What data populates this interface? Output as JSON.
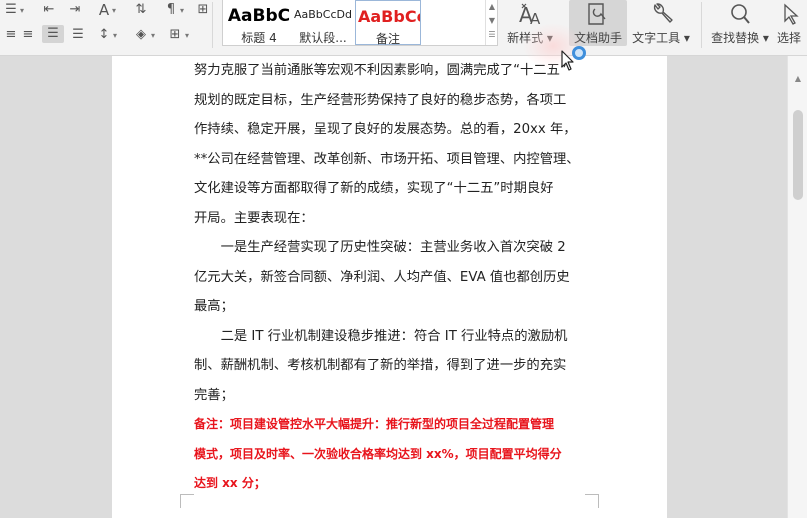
{
  "ribbon": {
    "styles": [
      {
        "preview": "AaBbC",
        "label": "标题 4"
      },
      {
        "preview": "AaBbCcDd",
        "label": "默认段..."
      },
      {
        "preview": "AaBbCcI",
        "label": "备注"
      }
    ],
    "new_style_label": "新样式",
    "doc_assistant_label": "文档助手",
    "text_tools_label": "文字工具",
    "find_replace_label": "查找替换",
    "select_label": "选择"
  },
  "document": {
    "lines": [
      "努力克服了当前通胀等宏观不利因素影响，圆满完成了“十二五”",
      "规划的既定目标，生产经营形势保持了良好的稳步态势，各项工",
      "作持续、稳定开展，呈现了良好的发展态势。总的看，20xx 年，",
      "**公司在经营管理、改革创新、市场开拓、项目管理、内控管理、",
      "文化建设等方面都取得了新的成绩，实现了“十二五”时期良好",
      "开局。主要表现在：",
      "　　一是生产经营实现了历史性突破：主营业务收入首次突破 2",
      "亿元大关，新签合同额、净利润、人均产值、EVA 值也都创历史",
      "最高；",
      "　　二是 IT 行业机制建设稳步推进：符合 IT 行业特点的激励机",
      "制、薪酬机制、考核机制都有了新的举措，得到了进一步的充实",
      "完善；"
    ],
    "note_lines": [
      "备注：项目建设管控水平大幅提升：推行新型的项目全过程配置管理",
      "模式，项目及时率、一次验收合格率均达到 xx%，项目配置平均得分",
      "达到 xx 分；"
    ]
  },
  "colors": {
    "note_red": "#e8141c",
    "accent_blue": "#3f8fdc"
  }
}
